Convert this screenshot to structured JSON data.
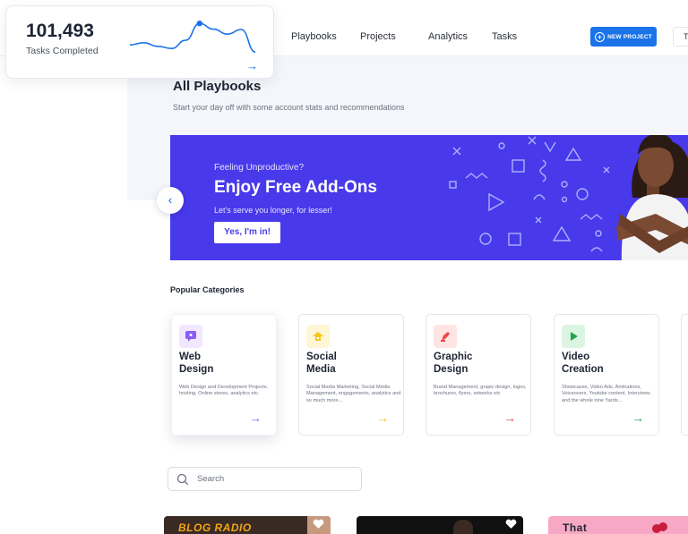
{
  "stats": {
    "value": "101,493",
    "label": "Tasks Completed",
    "arrow": "→",
    "sparkline": [
      0.32,
      0.38,
      0.28,
      0.22,
      0.45,
      0.92,
      0.76,
      0.62,
      0.75,
      0.12
    ],
    "highlight_index": 5
  },
  "nav": {
    "links": [
      "Playbooks",
      "Projects",
      "Analytics",
      "Tasks"
    ],
    "new_project_label": "NEW PROJECT",
    "truncated_button": "T"
  },
  "page": {
    "title": "All Playbooks",
    "subtitle": "Start your day off with some account stats and recommendations"
  },
  "banner": {
    "eyebrow": "Feeling Unproductive?",
    "heading": "Enjoy Free Add-Ons",
    "subtext": "Let's serve you longer, for lesser!",
    "button_label": "Yes, I'm in!",
    "prev_arrow": "‹"
  },
  "categories": {
    "title": "Popular Categories",
    "items": [
      {
        "title": "Web\nDesign",
        "description": "Web Design and Development Projects, hosting, Online stores, analytics etc.",
        "arrow": "→"
      },
      {
        "title": "Social\nMedia",
        "description": "Social Media Marketing, Social Media Management, engagements, analytics and so much more...",
        "arrow": "→"
      },
      {
        "title": "Graphic\nDesign",
        "description": "Brand Management, grapic design, logos, brochures, flyers, artworks etc",
        "arrow": "→"
      },
      {
        "title": "Video\nCreation",
        "description": "Showcases, Video Ads, Animations, Voiceovers, Youtube content, Interviews and the whole nine Yards...",
        "arrow": "→"
      }
    ]
  },
  "search": {
    "placeholder": "Search"
  },
  "thumbnails": [
    {
      "text": "BLOG RADIO"
    },
    {
      "text": ""
    },
    {
      "text": "That"
    }
  ],
  "colors": {
    "accent": "#1a73e8",
    "banner": "#4839eb",
    "web_design": "#8b5cf6",
    "social_media": "#f5c518",
    "graphic_design": "#ef4444",
    "video_creation": "#22a447"
  },
  "icons": {
    "web_design": "chat-bubble-icon",
    "social_media": "megaphone-icon",
    "graphic_design": "pen-tool-icon",
    "video_creation": "play-icon"
  }
}
